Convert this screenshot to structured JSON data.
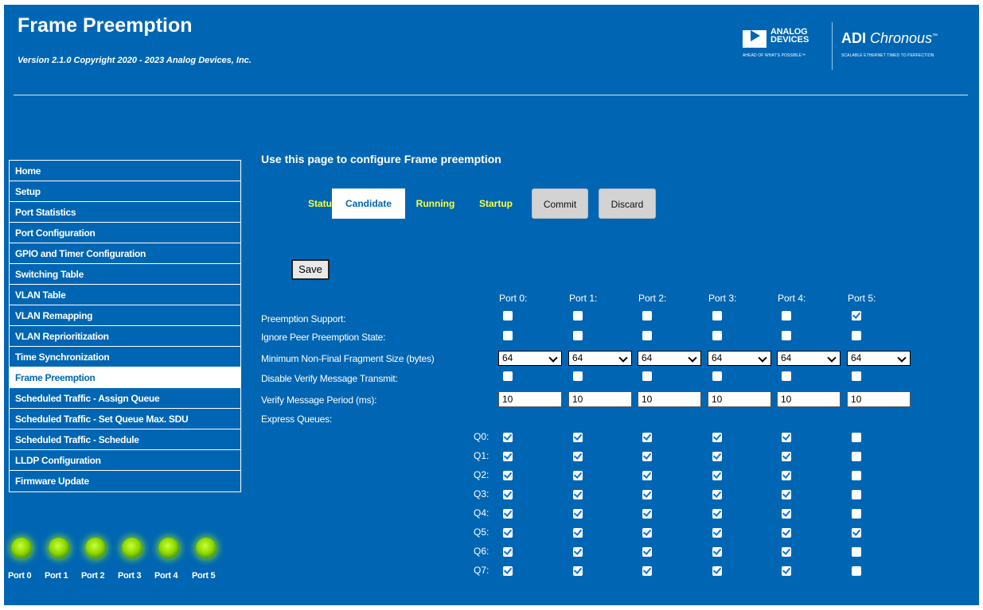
{
  "header": {
    "title": "Frame Preemption",
    "subtitle": "Version 2.1.0 Copyright 2020 - 2023 Analog Devices, Inc.",
    "logo_analog_line1": "ANALOG",
    "logo_analog_line2": "DEVICES",
    "logo_analog_tagline": "AHEAD OF WHAT'S POSSIBLE™",
    "logo_chronous_bold": "ADI",
    "logo_chronous_italic": "Chronous",
    "logo_chronous_tm": "™",
    "logo_chronous_tagline": "SCALABLE ETHERNET TIMED TO PERFECTION"
  },
  "sidebar": {
    "items": [
      {
        "label": "Home"
      },
      {
        "label": "Setup"
      },
      {
        "label": "Port Statistics"
      },
      {
        "label": "Port Configuration"
      },
      {
        "label": "GPIO and Timer Configuration"
      },
      {
        "label": "Switching Table"
      },
      {
        "label": "VLAN Table"
      },
      {
        "label": "VLAN Remapping"
      },
      {
        "label": "VLAN Reprioritization"
      },
      {
        "label": "Time Synchronization"
      },
      {
        "label": "Frame Preemption"
      },
      {
        "label": "Scheduled Traffic - Assign Queue"
      },
      {
        "label": "Scheduled Traffic - Set Queue Max. SDU"
      },
      {
        "label": "Scheduled Traffic - Schedule"
      },
      {
        "label": "LLDP Configuration"
      },
      {
        "label": "Firmware Update"
      }
    ],
    "active_index": 10
  },
  "port_leds": {
    "labels": [
      "Port 0",
      "Port 1",
      "Port 2",
      "Port 3",
      "Port 4",
      "Port 5"
    ],
    "color": "#8fd900"
  },
  "main": {
    "heading": "Use this page to configure Frame preemption",
    "tabs": [
      "Status",
      "Candidate",
      "Running",
      "Startup"
    ],
    "active_tab": "Candidate",
    "commit_label": "Commit",
    "discard_label": "Discard",
    "save_label": "Save"
  },
  "form": {
    "ports": [
      "Port 0:",
      "Port 1:",
      "Port 2:",
      "Port 3:",
      "Port 4:",
      "Port 5:"
    ],
    "labels": {
      "preemption_support": "Preemption Support:",
      "ignore_peer": "Ignore Peer Preemption State:",
      "min_fragment": "Minimum Non-Final Fragment Size (bytes)",
      "disable_verify": "Disable Verify Message Transmit:",
      "verify_period": "Verify Message Period (ms):",
      "express_queues": "Express Queues:"
    },
    "preemption_support": [
      false,
      false,
      false,
      false,
      false,
      true
    ],
    "ignore_peer": [
      false,
      false,
      false,
      false,
      false,
      false
    ],
    "min_fragment": [
      "64",
      "64",
      "64",
      "64",
      "64",
      "64"
    ],
    "disable_verify": [
      false,
      false,
      false,
      false,
      false,
      false
    ],
    "verify_period": [
      "10",
      "10",
      "10",
      "10",
      "10",
      "10"
    ],
    "queue_labels": [
      "Q0:",
      "Q1:",
      "Q2:",
      "Q3:",
      "Q4:",
      "Q5:",
      "Q6:",
      "Q7:"
    ],
    "express_queues": [
      [
        true,
        true,
        true,
        true,
        true,
        false
      ],
      [
        true,
        true,
        true,
        true,
        true,
        false
      ],
      [
        true,
        true,
        true,
        true,
        true,
        false
      ],
      [
        true,
        true,
        true,
        true,
        true,
        false
      ],
      [
        true,
        true,
        true,
        true,
        true,
        false
      ],
      [
        true,
        true,
        true,
        true,
        true,
        true
      ],
      [
        true,
        true,
        true,
        true,
        true,
        false
      ],
      [
        true,
        true,
        true,
        true,
        true,
        false
      ]
    ]
  },
  "colors": {
    "background": "#0066b3",
    "tab_link": "#ffff33",
    "active_bg": "#ffffff",
    "checkbox_check": "#0a72d9"
  }
}
